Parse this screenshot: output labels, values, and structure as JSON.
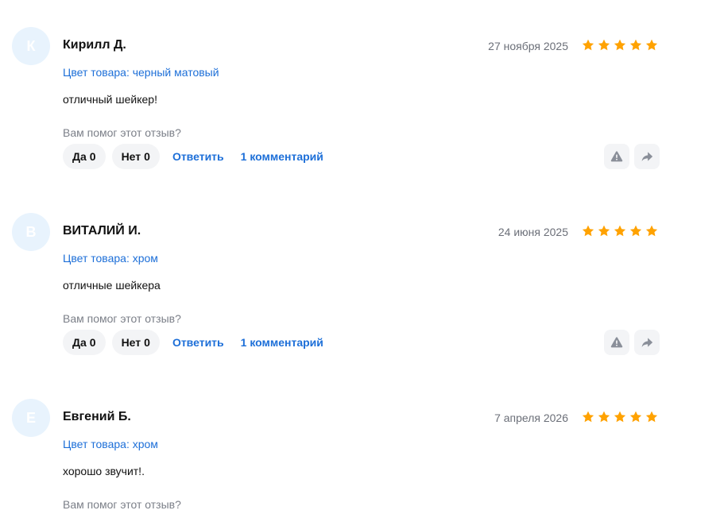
{
  "colors": {
    "accent": "#1d6fd8",
    "star": "#ffa200",
    "avatar_bg": "#e8f3fd",
    "muted": "#7b7f88",
    "pill_bg": "#f3f4f6"
  },
  "labels": {
    "helpful_question": "Вам помог этот отзыв?",
    "yes": "Да",
    "no": "Нет",
    "reply": "Ответить"
  },
  "reviews": [
    {
      "initial": "К",
      "name": "Кирилл Д.",
      "date": "27 ноября 2025",
      "rating": 5,
      "color": "Цвет товара: черный матовый",
      "text": "отличный шейкер!",
      "yes_count": "0",
      "no_count": "0",
      "comments": "1 комментарий"
    },
    {
      "initial": "В",
      "name": "ВИТАЛИЙ И.",
      "date": "24 июня 2025",
      "rating": 5,
      "color": "Цвет товара: хром",
      "text": "отличные шейкера",
      "yes_count": "0",
      "no_count": "0",
      "comments": "1 комментарий"
    },
    {
      "initial": "Е",
      "name": "Евгений Б.",
      "date": "7 апреля 2026",
      "rating": 5,
      "color": "Цвет товара: хром",
      "text": "хорошо звучит!.",
      "yes_count": "",
      "no_count": "",
      "comments": ""
    }
  ],
  "icons": {
    "report": "warning-icon",
    "share": "share-arrow-icon",
    "rating": "star-icon"
  }
}
